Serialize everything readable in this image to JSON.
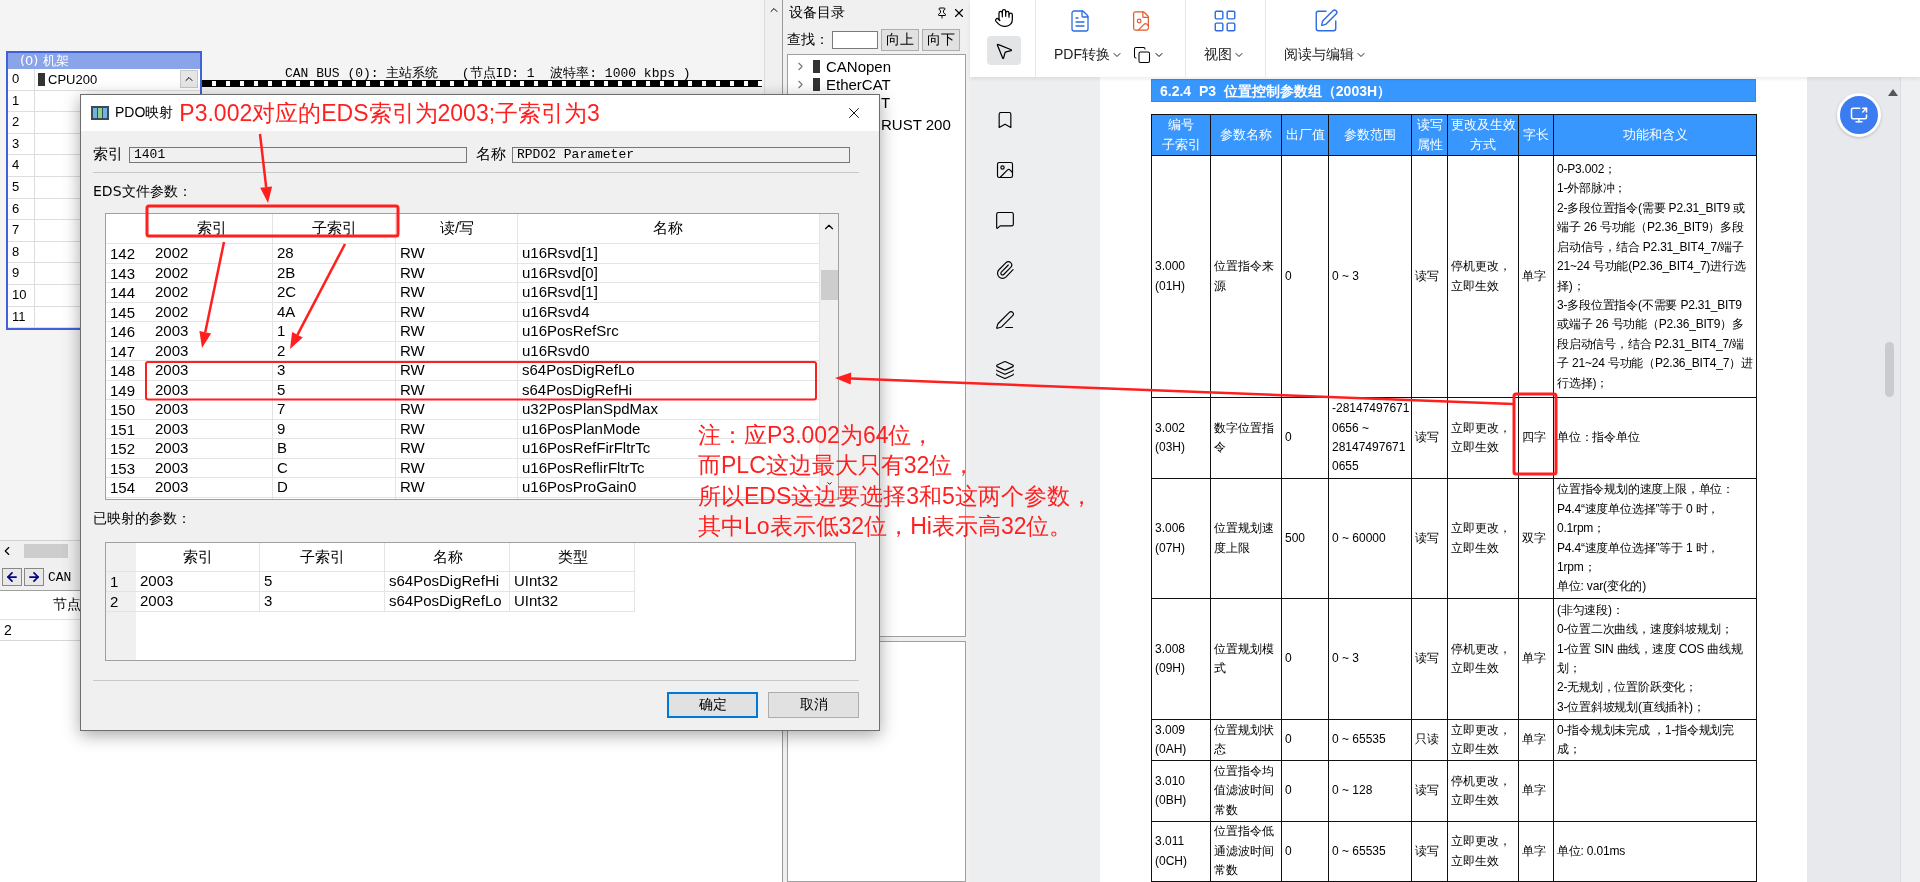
{
  "editor": {
    "rack": {
      "title": "(0) 机架",
      "rows": [
        {
          "slot": "0",
          "module": "CPU200"
        },
        {
          "slot": "1"
        },
        {
          "slot": "2"
        },
        {
          "slot": "3"
        },
        {
          "slot": "4"
        },
        {
          "slot": "5"
        },
        {
          "slot": "6"
        },
        {
          "slot": "7"
        },
        {
          "slot": "8"
        },
        {
          "slot": "9"
        },
        {
          "slot": "10"
        },
        {
          "slot": "11"
        }
      ]
    },
    "bus_label": "CAN BUS (0): 主站系统   (节点ID: 1  波特率: 1000 kbps )",
    "bottom_panel": {
      "tab": "CAN",
      "column": "节点",
      "rows": [
        "2"
      ]
    }
  },
  "device_catalog": {
    "title": "设备目录",
    "search_label": "查找：",
    "buttons": [
      "向上",
      "向下"
    ],
    "items": [
      {
        "kind": "node",
        "label": "CANopen"
      },
      {
        "kind": "node",
        "label": "EtherCAT"
      },
      {
        "kind": "fragment",
        "label": "T"
      },
      {
        "kind": "fragment",
        "label": "RUST 200"
      }
    ]
  },
  "dialog": {
    "title": "PDO映射",
    "index_label": "索引",
    "index_value": "1401",
    "name_label": "名称",
    "name_value": "RPDO2 Parameter",
    "eds_label": "EDS文件参数：",
    "eds_table": {
      "columns": [
        "索引",
        "子索引",
        "读/写",
        "名称"
      ],
      "rows": [
        {
          "row": "142",
          "cells": [
            "2002",
            "28",
            "RW",
            "u16Rsvd[1]"
          ]
        },
        {
          "row": "143",
          "cells": [
            "2002",
            "2B",
            "RW",
            "u16Rsvd[0]"
          ]
        },
        {
          "row": "144",
          "cells": [
            "2002",
            "2C",
            "RW",
            "u16Rsvd[1]"
          ]
        },
        {
          "row": "145",
          "cells": [
            "2002",
            "4A",
            "RW",
            "u16Rsvd4"
          ]
        },
        {
          "row": "146",
          "cells": [
            "2003",
            "1",
            "RW",
            "u16PosRefSrc"
          ]
        },
        {
          "row": "147",
          "cells": [
            "2003",
            "2",
            "RW",
            "u16Rsvd0"
          ]
        },
        {
          "row": "148",
          "cells": [
            "2003",
            "3",
            "RW",
            "s64PosDigRefLo"
          ]
        },
        {
          "row": "149",
          "cells": [
            "2003",
            "5",
            "RW",
            "s64PosDigRefHi"
          ]
        },
        {
          "row": "150",
          "cells": [
            "2003",
            "7",
            "RW",
            "u32PosPlanSpdMax"
          ]
        },
        {
          "row": "151",
          "cells": [
            "2003",
            "9",
            "RW",
            "u16PosPlanMode"
          ]
        },
        {
          "row": "152",
          "cells": [
            "2003",
            "B",
            "RW",
            "u16PosRefFirFltrTc"
          ]
        },
        {
          "row": "153",
          "cells": [
            "2003",
            "C",
            "RW",
            "u16PosReflirFltrTc"
          ]
        },
        {
          "row": "154",
          "cells": [
            "2003",
            "D",
            "RW",
            "u16PosProGain0"
          ]
        }
      ]
    },
    "mapped_label": "已映射的参数：",
    "mapped_table": {
      "columns": [
        "索引",
        "子索引",
        "名称",
        "类型"
      ],
      "rows": [
        {
          "row": "1",
          "cells": [
            "2003",
            "5",
            "s64PosDigRefHi",
            "UInt32"
          ]
        },
        {
          "row": "2",
          "cells": [
            "2003",
            "3",
            "s64PosDigRefLo",
            "UInt32"
          ]
        }
      ]
    },
    "buttons": [
      {
        "label": "确定",
        "focused": true
      },
      {
        "label": "取消",
        "focused": false
      }
    ]
  },
  "annotations": {
    "title_note": "P3.002对应的EDS索引为2003;子索引为3",
    "note_lines": [
      "注：应P3.002为64位，",
      "而PLC这边最大只有32位，",
      "所以EDS这边要选择3和5这两个参数，",
      "其中Lo表示低32位，Hi表示高32位。"
    ]
  },
  "pdf_viewer": {
    "tools": [
      {
        "kind": "hand",
        "selected": false
      },
      {
        "kind": "select",
        "selected": true
      }
    ],
    "menus": [
      {
        "kind": "convert",
        "label": "PDF转换"
      },
      {
        "kind": "view",
        "label": "视图"
      },
      {
        "kind": "edit",
        "label": "阅读与编辑"
      }
    ],
    "section_title": "6.2.4  P3  位置控制参数组（2003H）",
    "table": {
      "columns": [
        [
          "编号",
          "子索引"
        ],
        [
          "参数名称"
        ],
        [
          "出厂值"
        ],
        [
          "参数范围"
        ],
        [
          "读写",
          "属性"
        ],
        [
          "更改及生效",
          "方式"
        ],
        [
          "字长"
        ],
        [
          "功能和含义"
        ]
      ],
      "rows": [
        {
          "index": "3.000 (01H)",
          "name": "位置指令来源",
          "default": "0",
          "range": "0 ~ 3",
          "access": "读写",
          "mode": "停机更改，立即生效",
          "size": "单字",
          "description": [
            "0-P3.002；",
            "1-外部脉冲；",
            "2-多段位置指令(需要 P2.31_BIT9 或端子 26 号功能（P2.36_BIT9）多段启动信号，结合 P2.31_BIT4_7/端子 21~24 号功能(P2.36_BIT4_7)进行选择)；",
            "3-多段位置指令(不需要 P2.31_BIT9 或端子 26 号功能（P2.36_BIT9）多段启动信号，结合 P2.31_BIT4_7/端子 21~24 号功能（P2.36_BIT4_7）进行选择)；"
          ]
        },
        {
          "index": "3.002 (03H)",
          "name": "数字位置指令",
          "default": "0",
          "range": "-281474976710656 ~ 281474976710655",
          "access": "读写",
          "mode": "立即更改，立即生效",
          "size": "四字",
          "description": [
            "单位：指令单位"
          ]
        },
        {
          "index": "3.006 (07H)",
          "name": "位置规划速度上限",
          "default": "500",
          "range": "0 ~ 60000",
          "access": "读写",
          "mode": "立即更改，立即生效",
          "size": "双字",
          "description": [
            "位置指令规划的速度上限，单位：",
            "P4.4“速度单位选择”等于 0 时，0.1rpm；",
            "P4.4“速度单位选择”等于 1 时，1rpm；",
            "单位: var(变化的)"
          ]
        },
        {
          "index": "3.008 (09H)",
          "name": "位置规划模式",
          "default": "0",
          "range": "0 ~ 3",
          "access": "读写",
          "mode": "停机更改，立即生效",
          "size": "单字",
          "description": [
            "(非匀速段)：",
            "0-位置二次曲线，速度斜坡规划；",
            "1-位置 SIN 曲线，速度 COS 曲线规划；",
            "2-无规划，位置阶跃变化；",
            "3-位置斜坡规划(直线插补)；"
          ]
        },
        {
          "index": "3.009 (0AH)",
          "name": "位置规划状态",
          "default": "0",
          "range": "0 ~ 65535",
          "access": "只读",
          "mode": "立即更改，立即生效",
          "size": "单字",
          "description": [
            "0-指令规划未完成 ，1-指令规划完成；"
          ]
        },
        {
          "index": "3.010 (0BH)",
          "name": "位置指令均值滤波时间常数",
          "default": "0",
          "range": "0 ~ 128",
          "access": "读写",
          "mode": "停机更改，立即生效",
          "size": "单字"
        },
        {
          "index": "3.011 (0CH)",
          "name": "位置指令低通滤波时间常数",
          "default": "0",
          "range": "0 ~ 65535",
          "access": "读写",
          "mode": "立即更改，立即生效",
          "size": "单字",
          "description": [
            "单位: 0.01ms"
          ]
        }
      ]
    }
  }
}
